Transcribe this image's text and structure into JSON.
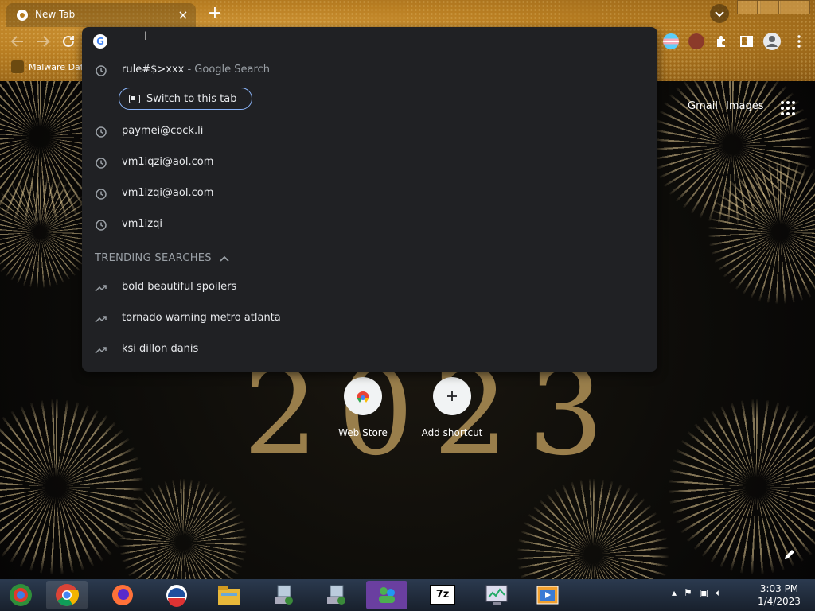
{
  "tab": {
    "title": "New Tab"
  },
  "bookmarks": {
    "items": [
      {
        "label": "Malware Dat"
      }
    ]
  },
  "omnibox": {
    "input_value": "",
    "matches": [
      {
        "text": "rule#$>xxx",
        "suffix": " - Google Search",
        "icon": "history-icon"
      }
    ],
    "switch_label": "Switch to this tab",
    "history": [
      {
        "text": "paymei@cock.li",
        "icon": "history-icon"
      },
      {
        "text": "vm1iqzi@aol.com",
        "icon": "history-icon"
      },
      {
        "text": "vm1izqi@aol.com",
        "icon": "history-icon"
      },
      {
        "text": "vm1izqi",
        "icon": "history-icon"
      }
    ],
    "trending_header": "TRENDING SEARCHES",
    "trending": [
      {
        "text": "bold beautiful spoilers",
        "icon": "trending-icon"
      },
      {
        "text": "tornado warning metro atlanta",
        "icon": "trending-icon"
      },
      {
        "text": "ksi dillon danis",
        "icon": "trending-icon"
      }
    ]
  },
  "ntp": {
    "links": {
      "gmail": "Gmail",
      "images": "Images"
    },
    "year_art": "2023",
    "shortcuts": [
      {
        "label": "Web Store",
        "icon": "web-store-icon"
      },
      {
        "label": "Add shortcut",
        "icon": "plus-icon"
      }
    ]
  },
  "taskbar": {
    "items": [
      "chrome-icon",
      "chrome-icon",
      "firefox-icon",
      "obama-logo-icon",
      "file-explorer-icon",
      "network-drive-icon",
      "network-drive-icon",
      "msn-messenger-icon",
      "7zip-icon",
      "task-manager-icon",
      "media-player-icon"
    ],
    "clock_time": "3:03 PM",
    "clock_date": "1/4/2023"
  },
  "colors": {
    "omnibox_bg": "#202124",
    "accent": "#8ab4f8",
    "suggestion_text": "#e8eaed",
    "dim_text": "#9aa0a6"
  }
}
